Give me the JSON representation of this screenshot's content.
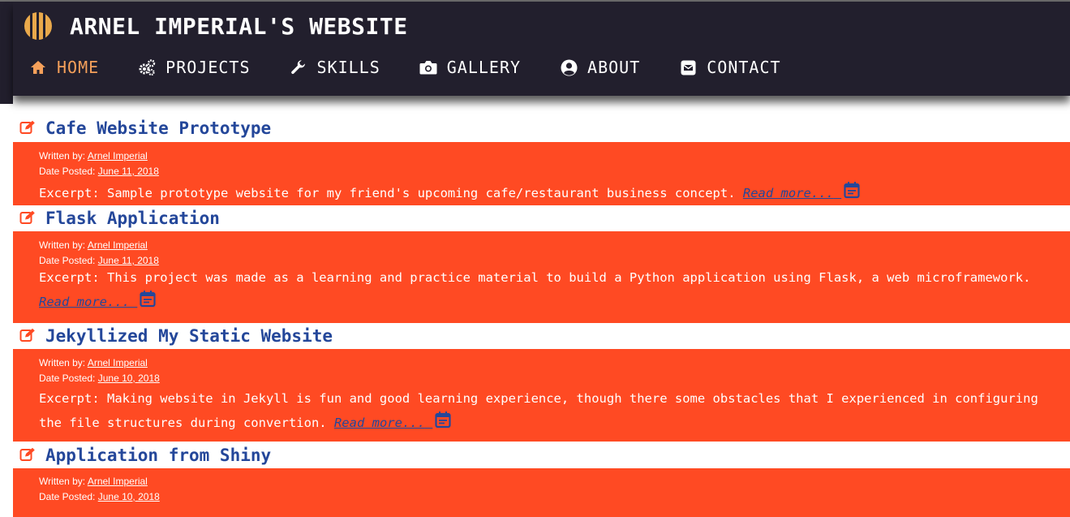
{
  "site": {
    "title": "ARNEL IMPERIAL'S WEBSITE"
  },
  "nav": {
    "home": "HOME",
    "projects": "PROJECTS",
    "skills": "SKILLS",
    "gallery": "GALLERY",
    "about": "ABOUT",
    "contact": "CONTACT"
  },
  "labels": {
    "written_by": "Written by:",
    "date_posted": "Date Posted:",
    "read_more": "Read more..."
  },
  "posts": [
    {
      "title": "Cafe Website Prototype",
      "author": "Arnel Imperial",
      "date": "June 11, 2018",
      "excerpt": "Excerpt: Sample prototype website for my friend's upcoming cafe/restaurant business concept."
    },
    {
      "title": "Flask Application",
      "author": "Arnel Imperial",
      "date": "June 11, 2018",
      "excerpt": "Excerpt: This project was made as a learning and practice material to build a Python application using Flask, a web microframework."
    },
    {
      "title": "Jekyllized My Static Website",
      "author": "Arnel Imperial",
      "date": "June 10, 2018",
      "excerpt": "Excerpt: Making website in Jekyll is fun and good learning experience, though there some obstacles that I experienced in configuring the file structures during convertion."
    },
    {
      "title": "Application from Shiny",
      "author": "Arnel Imperial",
      "date": "June 10, 2018",
      "excerpt": ""
    }
  ],
  "colors": {
    "header_bg": "#221f2d",
    "post_bg": "#ff4a23",
    "title_blue": "#24479a",
    "active_nav": "#f5a05a"
  }
}
